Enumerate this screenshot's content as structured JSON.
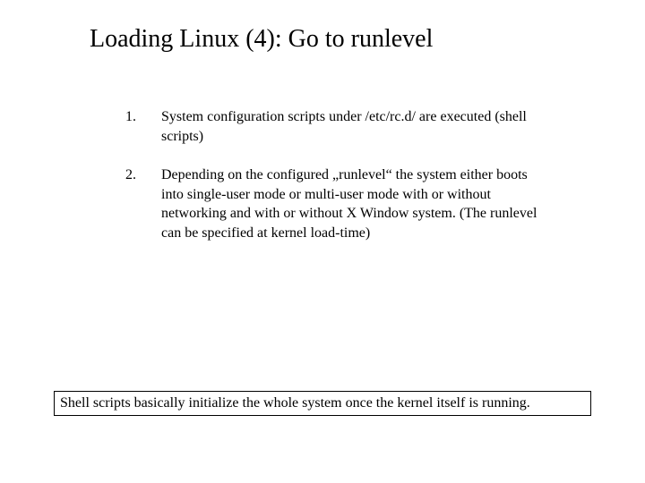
{
  "title": "Loading Linux (4): Go to runlevel",
  "items": [
    {
      "num": "1.",
      "text": "System configuration scripts under /etc/rc.d/ are executed (shell scripts)"
    },
    {
      "num": "2.",
      "text": "Depending on the configured „runlevel“ the system either boots into single-user mode or multi-user mode with or without networking and with or without X Window system. (The runlevel can be specified at kernel load-time)"
    }
  ],
  "footer": "Shell scripts basically initialize the whole system once the kernel itself is running."
}
